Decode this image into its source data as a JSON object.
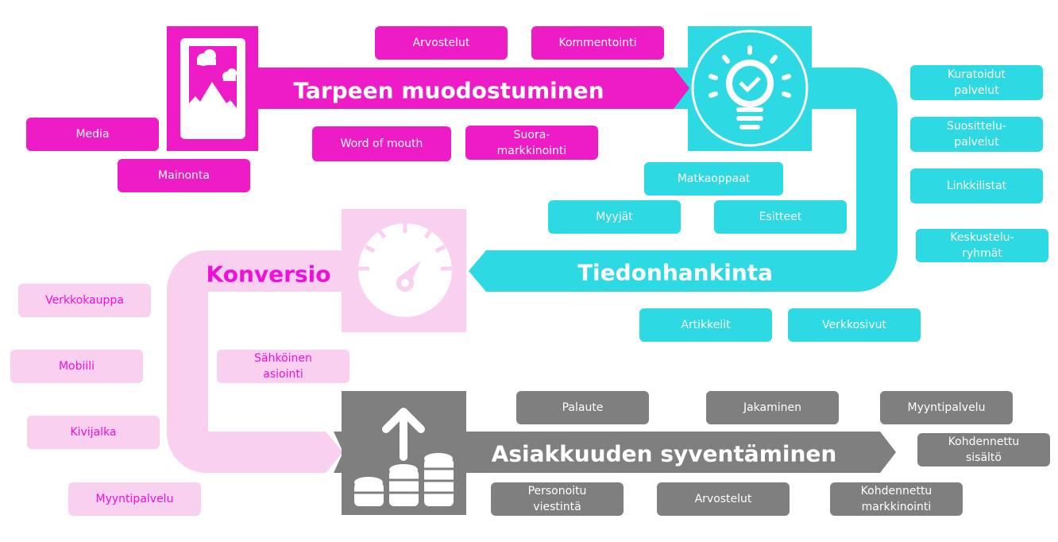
{
  "colors": {
    "need": "#ee1cc6",
    "info": "#2dd9e3",
    "conversion": "#fad0f0",
    "conversion_text": "#ee10d8",
    "deepen": "#7f7f7f"
  },
  "stages": {
    "need": {
      "title": "Tarpeen muodostuminen",
      "icon": "image-icon"
    },
    "info": {
      "title": "Tiedonhankinta",
      "icon": "lightbulb-icon"
    },
    "conversion": {
      "title": "Konversio",
      "icon": "speedometer-icon"
    },
    "deepen": {
      "title": "Asiakkuuden syventäminen",
      "icon": "coins-growth-icon"
    }
  },
  "need_items": [
    "Arvostelut",
    "Kommentointi",
    "Media",
    "Mainonta",
    "Word of mouth",
    "Suora-\nmarkkinointi"
  ],
  "info_items": [
    "Kuratoidut\npalvelut",
    "Suosittelu-\npalvelut",
    "Linkkilistat",
    "Keskustelu-\nryhmät",
    "Matkaoppaat",
    "Myyjät",
    "Esitteet",
    "Artikkelit",
    "Verkkosivut"
  ],
  "conversion_items": [
    "Verkkokauppa",
    "Mobiili",
    "Kivijalka",
    "Myyntipalvelu",
    "Sähköinen\nasiointi"
  ],
  "deepen_items": [
    "Palaute",
    "Jakaminen",
    "Myyntipalvelu",
    "Kohdennettu\nsisältö",
    "Personoitu\nviestintä",
    "Arvostelut",
    "Kohdennettu\nmarkkinointi"
  ]
}
